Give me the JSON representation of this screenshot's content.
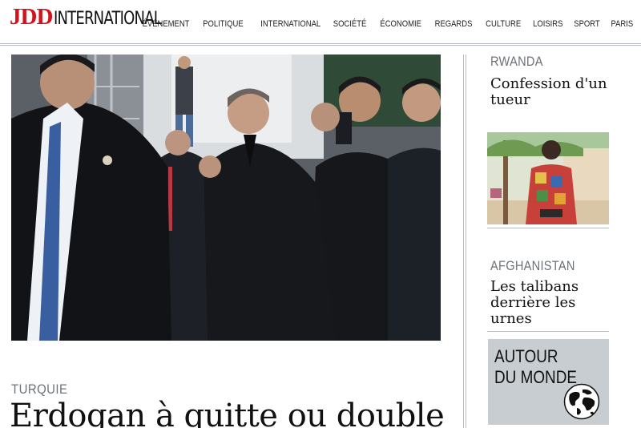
{
  "header": {
    "logo_brand": "JDD",
    "logo_section": "INTERNATIONAL",
    "nav": [
      "ÉVÉNEMENT",
      "POLITIQUE",
      "INTERNATIONAL",
      "SOCIÉTÉ",
      "ÉCONOMIE",
      "REGARDS",
      "CULTURE",
      "LOISIRS",
      "SPORT",
      "PARIS"
    ]
  },
  "main_article": {
    "kicker": "TURQUIE",
    "headline": "Erdogan à quitte ou double"
  },
  "sidebar": {
    "articles": [
      {
        "kicker": "RWANDA",
        "title": "Confession d'un tueur"
      },
      {
        "kicker": "AFGHANISTAN",
        "title": "Les talibans derrière les urnes"
      }
    ],
    "world_box": {
      "line1": "AUTOUR",
      "line2": "DU MONDE"
    }
  },
  "colors": {
    "brand_red": "#d0131c",
    "kicker_gray": "#6d7277",
    "world_box_bg": "#c7cdd1"
  }
}
